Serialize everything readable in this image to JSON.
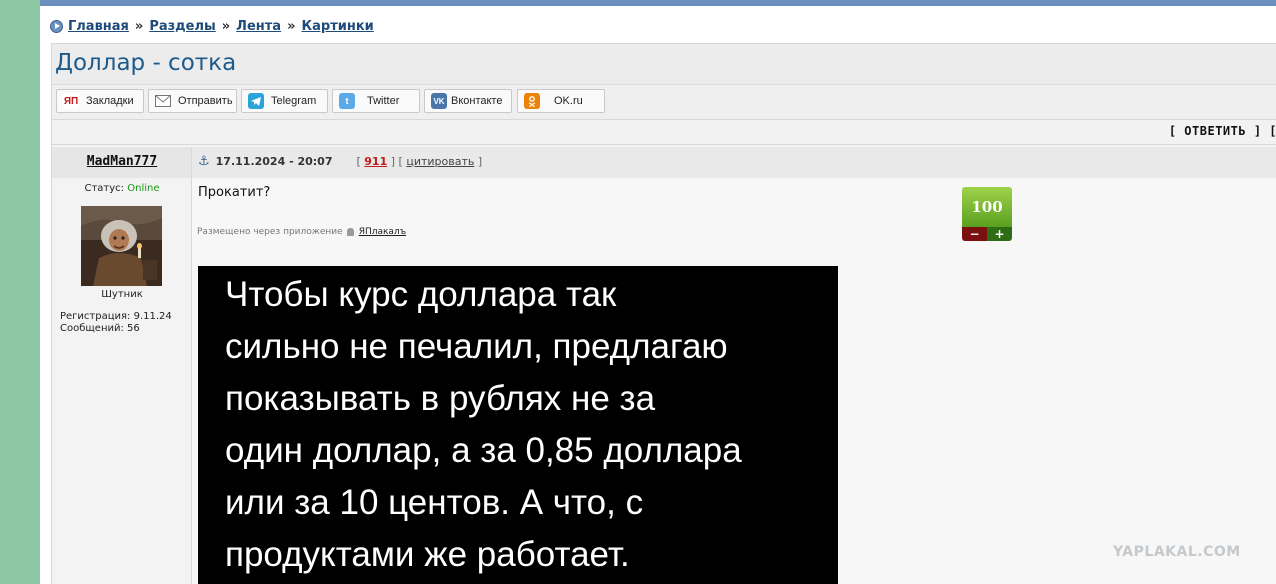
{
  "breadcrumbs": {
    "items": [
      "Главная",
      "Разделы",
      "Лента",
      "Картинки"
    ],
    "separator": "»"
  },
  "page_title": "Доллар - сотка",
  "share": {
    "buttons": [
      {
        "label": "Закладки",
        "icon": "yaplakal-icon",
        "color": "#ffffff",
        "badge": "ЯП"
      },
      {
        "label": "Отправить",
        "icon": "mail-icon",
        "color": "#ffffff"
      },
      {
        "label": "Telegram",
        "icon": "telegram-icon",
        "color": "#29a3d9"
      },
      {
        "label": "Twitter",
        "icon": "twitter-icon",
        "color": "#5aa9e8"
      },
      {
        "label": "Вконтакте",
        "icon": "vk-icon",
        "color": "#4a76a8",
        "badge": "VK"
      },
      {
        "label": "OK.ru",
        "icon": "ok-icon",
        "color": "#ee8208"
      }
    ]
  },
  "reply_link": "[ ОТВЕТИТЬ ] [",
  "post": {
    "author": "MadMan777",
    "date": "17.11.2024 - 20:07",
    "number": "911",
    "quote_label": "цитировать",
    "status_label": "Статус:",
    "status_value": "Online",
    "rank": "Шутник",
    "registration": "Регистрация: 9.11.24",
    "messages": "Сообщений: 56",
    "text": "Прокатит?",
    "via_label": "Размещено через приложение",
    "via_app": "ЯПлакалъ",
    "rating": "100",
    "rating_minus": "−",
    "rating_plus": "+",
    "image_text": "Чтобы курс доллара так\nсильно не печалил, предлагаю\nпоказывать в рублях не за\nодин доллар, а за 0,85 доллара\nили за 10 центов. А что, с\nпродуктами же работает."
  },
  "watermark": "YAPLAKAL.COM",
  "colors": {
    "link": "#1e4b7a",
    "title": "#1d5a8c",
    "online": "#1a9a1a",
    "post_number": "#c21b1b",
    "rating_green": "#6fb52b"
  }
}
